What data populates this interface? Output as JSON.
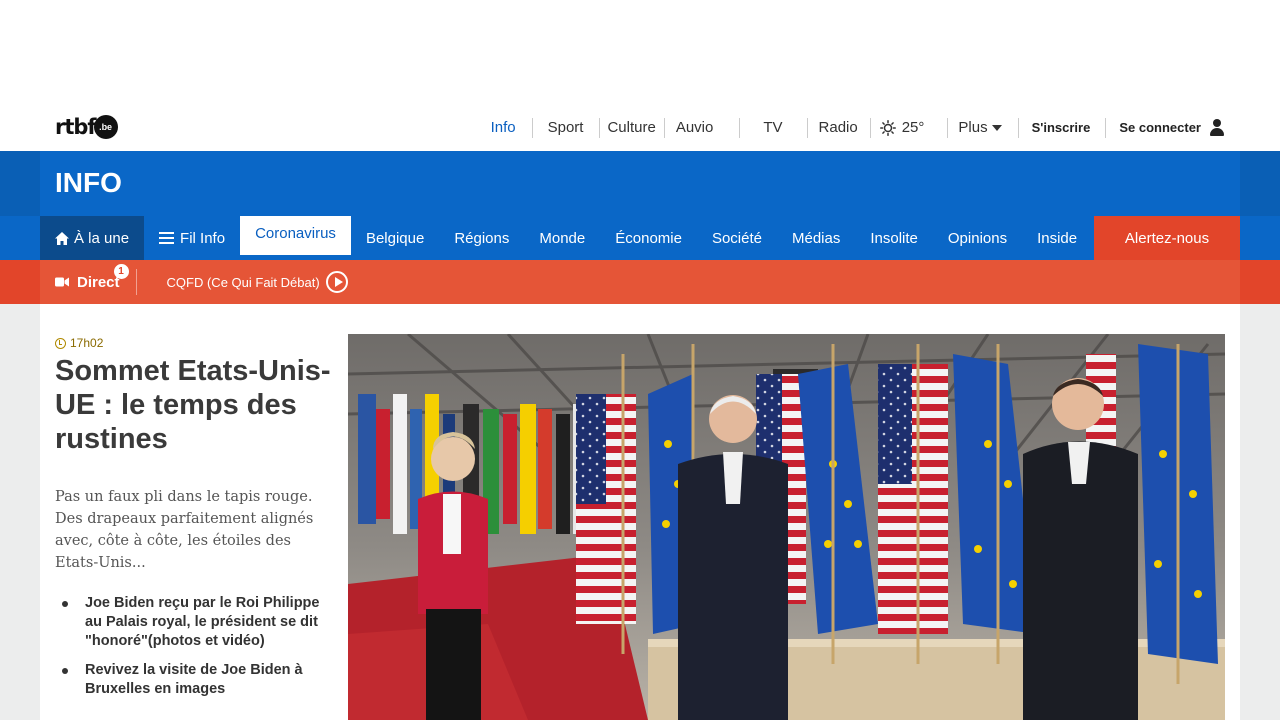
{
  "brand": {
    "logo_text": "rtbf",
    "logo_suffix": ".be"
  },
  "topnav": {
    "items": [
      {
        "label": "Info",
        "active": true
      },
      {
        "label": "Sport"
      },
      {
        "label": "Culture"
      },
      {
        "label": "Auvio"
      },
      {
        "label": "TV"
      },
      {
        "label": "Radio"
      }
    ],
    "weather": "25°",
    "more": "Plus",
    "signup": "S'inscrire",
    "login": "Se connecter"
  },
  "section_title": "INFO",
  "secnav": {
    "home": "À la une",
    "fil": "Fil Info",
    "tabs": [
      "Coronavirus",
      "Belgique",
      "Régions",
      "Monde",
      "Économie",
      "Société",
      "Médias",
      "Insolite",
      "Opinions",
      "Inside"
    ],
    "active_tab": "Coronavirus",
    "alert": "Alertez-nous"
  },
  "livebar": {
    "direct": "Direct",
    "badge": "1",
    "program": "CQFD (Ce Qui Fait Débat)"
  },
  "article": {
    "time": "17h02",
    "headline": "Sommet Etats-Unis-UE : le temps des rustines",
    "lead": "Pas un faux pli dans le tapis rouge. Des drapeaux parfaitement alignés avec, côte à côte, les étoiles des Etats-Unis...",
    "related": [
      "Joe Biden reçu par le Roi Philippe au Palais royal, le président se dit \"honoré\"(photos et vidéo)",
      "Revivez la visite de Joe Biden à Bruxelles en images"
    ]
  },
  "colors": {
    "brand_blue": "#0a67c7",
    "live_orange": "#e2452a"
  }
}
